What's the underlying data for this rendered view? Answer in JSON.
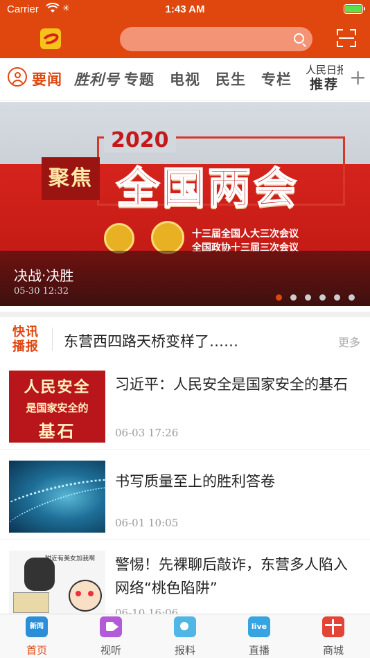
{
  "status_bar": {
    "carrier": "Carrier",
    "time": "1:43 AM"
  },
  "header": {
    "search_placeholder": ""
  },
  "tabs": {
    "items": [
      "要闻",
      "胜利号",
      "专题",
      "电视",
      "民生",
      "专栏"
    ],
    "rmrb_top": "人民日报",
    "rmrb_bottom": "推荐",
    "plus": "+"
  },
  "banner": {
    "year": "2020",
    "focus": "聚焦",
    "headline": "全国两会",
    "sub1": "十三届全国人大三次会议",
    "sub2": "全国政协十三届三次会议",
    "caption": "决战·决胜",
    "time": "05-30 12:32",
    "dots_total": 6,
    "dot_active": 0
  },
  "flash": {
    "label_line1": "快讯",
    "label_line2": "播报",
    "text": "东营西四路天桥变样了……",
    "more": "更多"
  },
  "news": [
    {
      "title": "习近平：人民安全是国家安全的基石",
      "time": "06-03 17:26",
      "thumb_lines": [
        "人民安全",
        "是国家安全的",
        "基石"
      ]
    },
    {
      "title": "书写质量至上的胜利答卷",
      "time": "06-01 10:05"
    },
    {
      "title": "警惕！先裸聊后敲诈，东营多人陷入网络“桃色陷阱”",
      "time": "06-10 16:06",
      "thumb_note": "附近有美女加我啊"
    }
  ],
  "tabbar": {
    "items": [
      {
        "label": "首页",
        "icon": "news-home-icon",
        "badge": "新闻"
      },
      {
        "label": "视听",
        "icon": "video-icon"
      },
      {
        "label": "报料",
        "icon": "camera-icon"
      },
      {
        "label": "直播",
        "icon": "live-icon",
        "badge": "live"
      },
      {
        "label": "商城",
        "icon": "gift-icon"
      }
    ]
  },
  "colors": {
    "brand": "#e0470f",
    "muted": "#999999"
  }
}
